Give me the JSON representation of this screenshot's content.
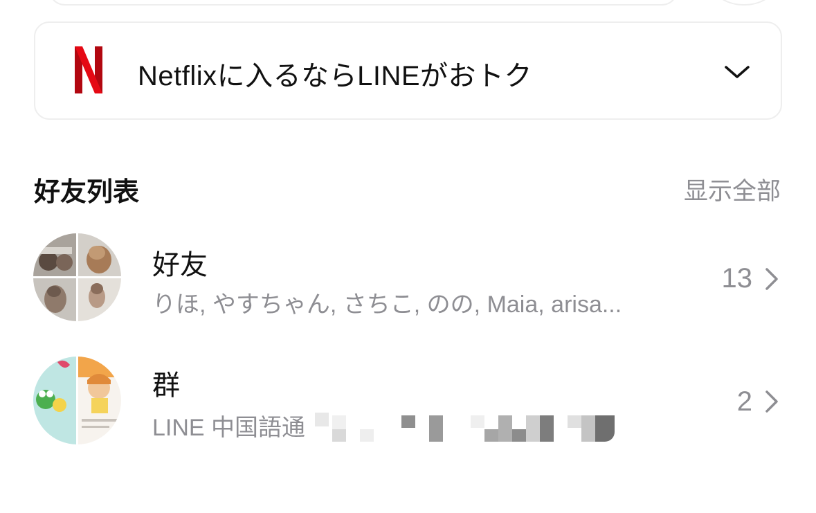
{
  "banner": {
    "text": "Netflixに入るならLINEがおトク",
    "logo_icon": "netflix-logo-icon",
    "chevron_icon": "chevron-down-icon",
    "brand_color": "#d1181f"
  },
  "friends_section": {
    "title": "好友列表",
    "show_all": "显示全部"
  },
  "rows": [
    {
      "title": "好友",
      "subtitle": "りほ, やすちゃん, さちこ, のの, Maia, arisa...",
      "count": "13",
      "arrow_icon": "chevron-right-icon"
    },
    {
      "title": "群",
      "subtitle": "LINE 中国語通",
      "count": "2",
      "arrow_icon": "chevron-right-icon"
    }
  ],
  "colors": {
    "secondary_text": "#8e8e93",
    "primary_text": "#111111",
    "border": "#eeeeee"
  }
}
